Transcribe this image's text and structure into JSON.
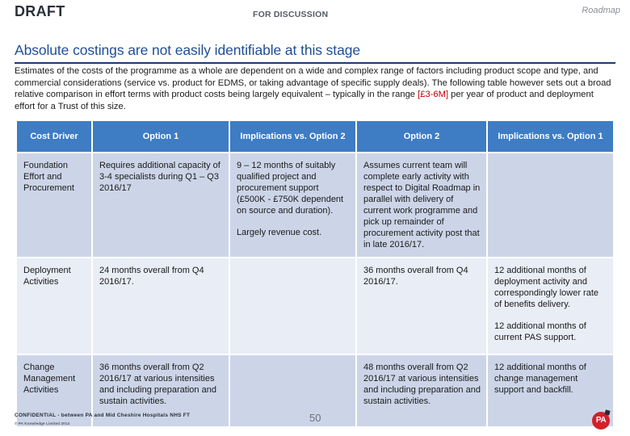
{
  "header": {
    "draft_label": "DRAFT",
    "status_label": "FOR DISCUSSION",
    "deck_name": "Roadmap"
  },
  "slide": {
    "title": "Absolute costings are not easily identifiable at this stage",
    "intro_part_1": "Estimates of the costs of the programme as a whole are dependent on a wide and complex range of factors including product scope and type, and commercial considerations (service vs. product for EDMS, or taking advantage of specific supply deals).  The following table however sets out a broad relative comparison in effort terms with product costs being largely equivalent – typically in the range ",
    "intro_cost_range": "[£3-6M]",
    "intro_part_2": " per year of product and deployment effort for a Trust of this size."
  },
  "table": {
    "columns": [
      "Cost Driver",
      "Option 1",
      "Implications vs. Option 2",
      "Option 2",
      "Implications vs. Option 1"
    ],
    "rows": [
      {
        "driver": "Foundation Effort and Procurement",
        "option_1": [
          "Requires additional capacity of 3-4 specialists during Q1 – Q3 2016/17"
        ],
        "implications_vs_option_2": [
          "9 – 12 months of suitably qualified project and procurement support (£500K - £750K dependent on source and duration).",
          "Largely revenue cost."
        ],
        "option_2": [
          "Assumes current team will complete early activity with respect to Digital Roadmap in parallel with delivery of current work programme and pick up remainder of procurement activity post that in late 2016/17."
        ],
        "implications_vs_option_1": []
      },
      {
        "driver": "Deployment Activities",
        "option_1": [
          "24 months overall from Q4 2016/17."
        ],
        "implications_vs_option_2": [],
        "option_2": [
          "36 months overall from Q4 2016/17."
        ],
        "implications_vs_option_1": [
          "12 additional months of deployment activity and correspondingly lower rate of benefits delivery.",
          "12 additional months of current PAS support."
        ]
      },
      {
        "driver": "Change Management Activities",
        "option_1": [
          "36 months overall from Q2 2016/17 at various intensities and including preparation and sustain activities."
        ],
        "implications_vs_option_2": [],
        "option_2": [
          "48 months overall from Q2 2016/17 at various intensities and including preparation and sustain activities."
        ],
        "implications_vs_option_1": [
          "12 additional months of change management support and backfill."
        ]
      }
    ]
  },
  "footer": {
    "confidential": "CONFIDENTIAL - between PA and Mid Cheshire Hospitals NHS FT",
    "copyright": "© PA Knowledge Limited 2014",
    "page_number": "50",
    "logo_text": "PA"
  },
  "colors": {
    "title_blue": "#1f4e96",
    "rule_blue": "#1a3b6e",
    "header_blue": "#3e7cc4",
    "band_dark": "#ccd5e8",
    "band_light": "#e9edf6",
    "cost_red": "#c00000",
    "logo_red": "#d3202b"
  }
}
